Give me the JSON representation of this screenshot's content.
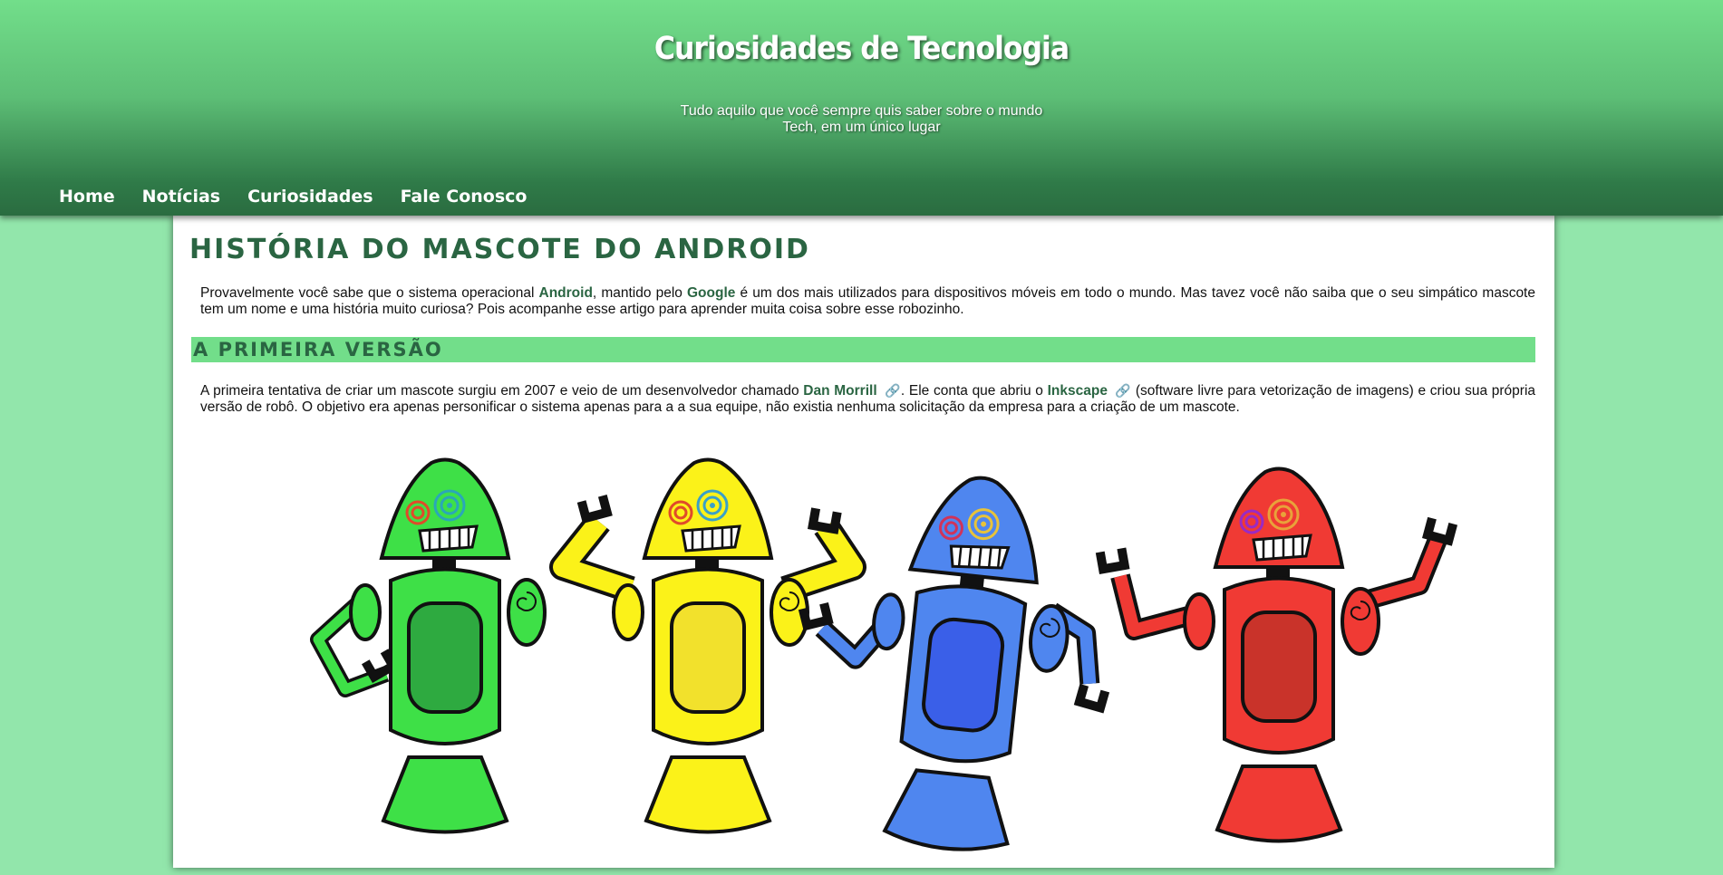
{
  "site": {
    "title": "Curiosidades de Tecnologia",
    "subtitle_line1": "Tudo aquilo que você sempre quis saber sobre o mundo",
    "subtitle_line2": "Tech, em um único lugar"
  },
  "nav": [
    {
      "label": "Home"
    },
    {
      "label": "Notícias"
    },
    {
      "label": "Curiosidades"
    },
    {
      "label": "Fale Conosco"
    }
  ],
  "article": {
    "title": "História do Mascote do Android",
    "intro": {
      "t1": "Provavelmente você sabe que o sistema operacional ",
      "l1": "Android",
      "t2": ", mantido pelo ",
      "l2": "Google",
      "t3": " é um dos mais utilizados para dispositivos móveis em todo o mundo. Mas tavez você não saiba que o seu simpático mascote tem um nome e uma história muito curiosa? Pois acompanhe esse artigo para aprender muita coisa sobre esse robozinho."
    },
    "section1": {
      "title": "A primeira versão",
      "t1": "A primeira tentativa de criar um mascote surgiu em 2007 e veio de um desenvolvedor chamado ",
      "l1": "Dan Morrill",
      "t2": ". Ele conta que abriu o ",
      "l2": "Inkscape",
      "t3": " (software livre para vetorização de imagens) e criou sua própria versão de robô. O objetivo era apenas personificar o sistema apenas para a a sua equipe, não existia nenhuma solicitação da empresa para a criação de um mascote.",
      "link_icon": "link-icon"
    }
  },
  "robots": [
    {
      "body": "#3ee047",
      "panel": "#2eaa40",
      "swirl_left": "#e04a2a",
      "swirl_right": "#2aa7b8"
    },
    {
      "body": "#fbf219",
      "panel": "#f2e12c",
      "swirl_left": "#e04a2a",
      "swirl_right": "#3aa0c8"
    },
    {
      "body": "#4f86ef",
      "panel": "#3a5fe8",
      "swirl_left": "#d0335a",
      "swirl_right": "#e8c33a"
    },
    {
      "body": "#f03a34",
      "panel": "#c9332a",
      "swirl_left": "#9a2ac4",
      "swirl_right": "#e8a23a"
    }
  ],
  "colors": {
    "header_top": "#72de8a",
    "header_bottom": "#2a6c40",
    "page_bg": "#92e6ab",
    "accent": "#2a6542",
    "section_bar": "#72de8a"
  }
}
